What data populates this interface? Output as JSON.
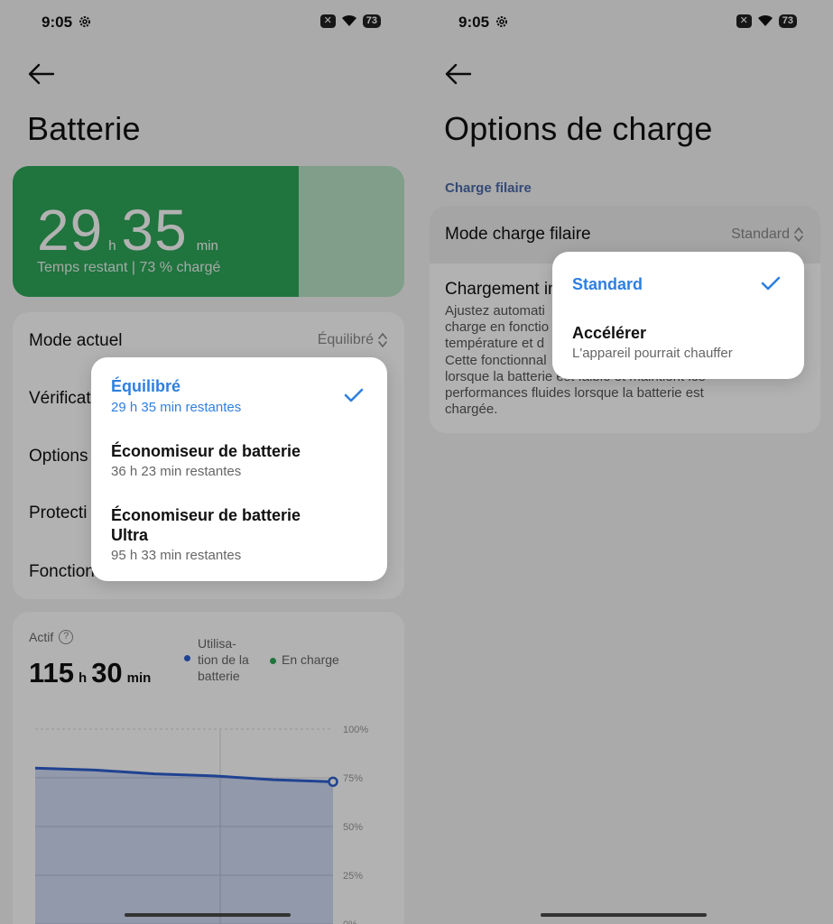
{
  "status": {
    "time": "9:05",
    "battery": "73"
  },
  "left": {
    "title": "Batterie",
    "hero": {
      "hours": "29",
      "hours_unit": "h",
      "minutes": "35",
      "minutes_unit": "min",
      "subtitle": "Temps restant | 73 % chargé",
      "charge_fraction": 0.73
    },
    "settings": {
      "mode_label": "Mode actuel",
      "mode_value": "Équilibré",
      "row2": "Vérificat",
      "row3": "Options",
      "row4": "Protecti",
      "row5": "Fonction"
    },
    "active": {
      "label": "Actif",
      "hours": "115",
      "hours_unit": "h",
      "minutes": "30",
      "minutes_unit": "min",
      "legend_usage_1": "Utilisa-",
      "legend_usage_2": "tion de la",
      "legend_usage_3": "batterie",
      "legend_charge": "En charge"
    },
    "popup": {
      "options": [
        {
          "title": "Équilibré",
          "subtitle": "29 h 35 min restantes",
          "selected": true
        },
        {
          "title": "Économiseur de batterie",
          "subtitle": "36 h 23 min restantes",
          "selected": false
        },
        {
          "title_line1": "Économiseur de batterie",
          "title_line2": "Ultra",
          "subtitle": "95 h 33 min restantes",
          "selected": false
        }
      ]
    }
  },
  "chart_data": {
    "type": "area",
    "y_ticks": [
      "100%",
      "75%",
      "50%",
      "25%",
      "0%"
    ],
    "ylim": [
      0,
      100
    ],
    "series": [
      {
        "name": "Utilisation de la batterie",
        "color": "#2f5fd0",
        "values": [
          80,
          79,
          77,
          76,
          74,
          73
        ]
      }
    ]
  },
  "right": {
    "title": "Options de charge",
    "section": "Charge filaire",
    "mode_label": "Mode charge filaire",
    "mode_value": "Standard",
    "row2_title": "Chargement in",
    "desc_lines": [
      "Ajustez automati",
      "charge en fonctio",
      "température et d",
      "Cette fonctionnal",
      "lorsque la batterie est faible et maintient les",
      "performances fluides lorsque la batterie est",
      "chargée."
    ],
    "popup": {
      "options": [
        {
          "title": "Standard",
          "selected": true
        },
        {
          "title": "Accélérer",
          "subtitle": "L'appareil pourrait chauffer",
          "selected": false
        }
      ]
    }
  },
  "colors": {
    "accent": "#2f7fe0",
    "battery_green": "#2fa65a",
    "usage_blue": "#2f5fd0",
    "charge_green": "#2fa65a"
  }
}
